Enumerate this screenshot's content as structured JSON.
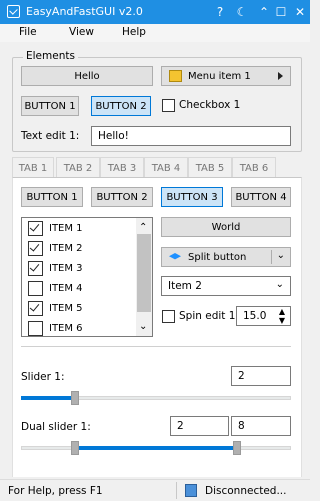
{
  "window": {
    "title": "EasyAndFastGUI v2.0",
    "help_glyph": "?",
    "theme_glyph": "☾",
    "up_glyph": "⌃",
    "max_glyph": "☐",
    "close_glyph": "✕"
  },
  "menubar": {
    "file": "File",
    "view": "View",
    "help": "Help"
  },
  "elements": {
    "group_title": "Elements",
    "hello_button": "Hello",
    "menu_item_1": "Menu item 1",
    "button_1": "BUTTON 1",
    "button_2": "BUTTON 2",
    "checkbox_1_label": "Checkbox 1",
    "checkbox_1_checked": false,
    "text_edit_label": "Text edit 1:",
    "text_edit_value": "Hello!"
  },
  "tabs": [
    {
      "label": "TAB 1",
      "selected": true
    },
    {
      "label": "TAB 2",
      "selected": false
    },
    {
      "label": "TAB 3",
      "selected": false
    },
    {
      "label": "TAB 4",
      "selected": false
    },
    {
      "label": "TAB 5",
      "selected": false
    },
    {
      "label": "TAB 6",
      "selected": false
    }
  ],
  "tab1": {
    "buttons": [
      "BUTTON 1",
      "BUTTON 2",
      "BUTTON 3",
      "BUTTON 4"
    ],
    "active_button_index": 2,
    "list": [
      {
        "label": "ITEM 1",
        "checked": true
      },
      {
        "label": "ITEM 2",
        "checked": true
      },
      {
        "label": "ITEM 3",
        "checked": true
      },
      {
        "label": "ITEM 4",
        "checked": false
      },
      {
        "label": "ITEM 5",
        "checked": true
      },
      {
        "label": "ITEM 6",
        "checked": false
      }
    ],
    "world_button": "World",
    "split_button": "Split button",
    "combo_value": "Item 2",
    "spin_label": "Spin edit 1:",
    "spin_value": "15.0",
    "spin_checked": false,
    "slider_label": "Slider 1:",
    "slider_value": "2",
    "slider_fraction": 0.2,
    "dual_slider_label": "Dual slider 1:",
    "dual_low": "2",
    "dual_high": "8",
    "dual_low_fraction": 0.2,
    "dual_high_fraction": 0.8
  },
  "status": {
    "help_text": "For Help, press F1",
    "connection_text": "Disconnected..."
  },
  "colors": {
    "titlebar": "#1f8fe3",
    "accent": "#0078d7",
    "active_button_bg": "#cce4f7"
  }
}
